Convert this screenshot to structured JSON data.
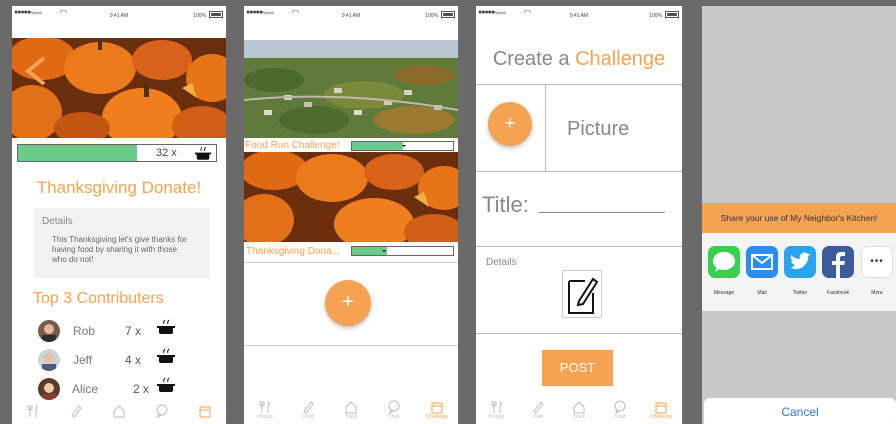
{
  "status": {
    "carrier": "●●●●●",
    "carrier_sub": "Sketch",
    "time": "9:41 AM",
    "battery": "100%"
  },
  "tabs": [
    "Pickup",
    "Post",
    "Track",
    "Chat",
    "Challenge"
  ],
  "screen1": {
    "progress_value": "32 x",
    "progress_fraction": 0.6,
    "title": "Thanksgiving Donate!",
    "details_label": "Details",
    "details_text": "This Thanksgiving let's give thanks for having food by sharing it with those who do not!",
    "top_heading": "Top 3 Contributers",
    "contributors": [
      {
        "name": "Rob",
        "count": "7 x"
      },
      {
        "name": "Jeff",
        "count": "4 x"
      },
      {
        "name": "Alice",
        "count": "2 x"
      }
    ]
  },
  "screen2": {
    "challenge1_label": "Food Run Challenge!",
    "challenge1_progress": 0.5,
    "challenge2_label": "Thanksgiving Dona...",
    "challenge2_progress": 0.35,
    "add_label": "+"
  },
  "screen3": {
    "title_plain": "Create a ",
    "title_accent": "Challenge",
    "add_label": "+",
    "picture_label": "Picture",
    "title_field_label": "Title:",
    "details_label": "Details",
    "post_label": "POST"
  },
  "screen4": {
    "share_banner": "Share your use of My Neighbor's Kitchen!",
    "apps": [
      "Message",
      "Mail",
      "Twitter",
      "Facebook",
      "More"
    ],
    "more_glyph": "•••",
    "cancel_label": "Cancel"
  },
  "colors": {
    "accent": "#f5a352",
    "progress": "#6bcb8a"
  }
}
